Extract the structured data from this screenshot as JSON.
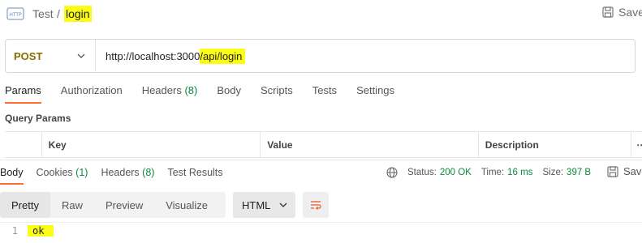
{
  "header": {
    "icon": "http-icon",
    "breadcrumb_parent": "Test",
    "breadcrumb_separator": "/",
    "breadcrumb_current": "login",
    "save_label": "Save"
  },
  "request": {
    "method": "POST",
    "url_base": "http://localhost:3000",
    "url_path": "/api/login"
  },
  "request_tabs": [
    {
      "label": "Params",
      "count": ""
    },
    {
      "label": "Authorization",
      "count": ""
    },
    {
      "label": "Headers",
      "count": "(8)"
    },
    {
      "label": "Body",
      "count": ""
    },
    {
      "label": "Scripts",
      "count": ""
    },
    {
      "label": "Tests",
      "count": ""
    },
    {
      "label": "Settings",
      "count": ""
    }
  ],
  "query_params": {
    "title": "Query Params",
    "columns": [
      "Key",
      "Value",
      "Description"
    ]
  },
  "response_tabs": [
    {
      "label": "Body",
      "count": ""
    },
    {
      "label": "Cookies",
      "count": "(1)"
    },
    {
      "label": "Headers",
      "count": "(8)"
    },
    {
      "label": "Test Results",
      "count": ""
    }
  ],
  "response_meta": {
    "status_key": "Status:",
    "status_value": "200 OK",
    "time_key": "Time:",
    "time_value": "16 ms",
    "size_key": "Size:",
    "size_value": "397 B",
    "save_label": "Save"
  },
  "view_modes": [
    "Pretty",
    "Raw",
    "Preview",
    "Visualize"
  ],
  "format": "HTML",
  "response_body": [
    {
      "line": "1",
      "text": "ok"
    }
  ],
  "colors": {
    "highlight": "#fcfc19",
    "accent": "#ff6c37",
    "method_post": "#8a6d00",
    "success": "#0b8a3c"
  }
}
